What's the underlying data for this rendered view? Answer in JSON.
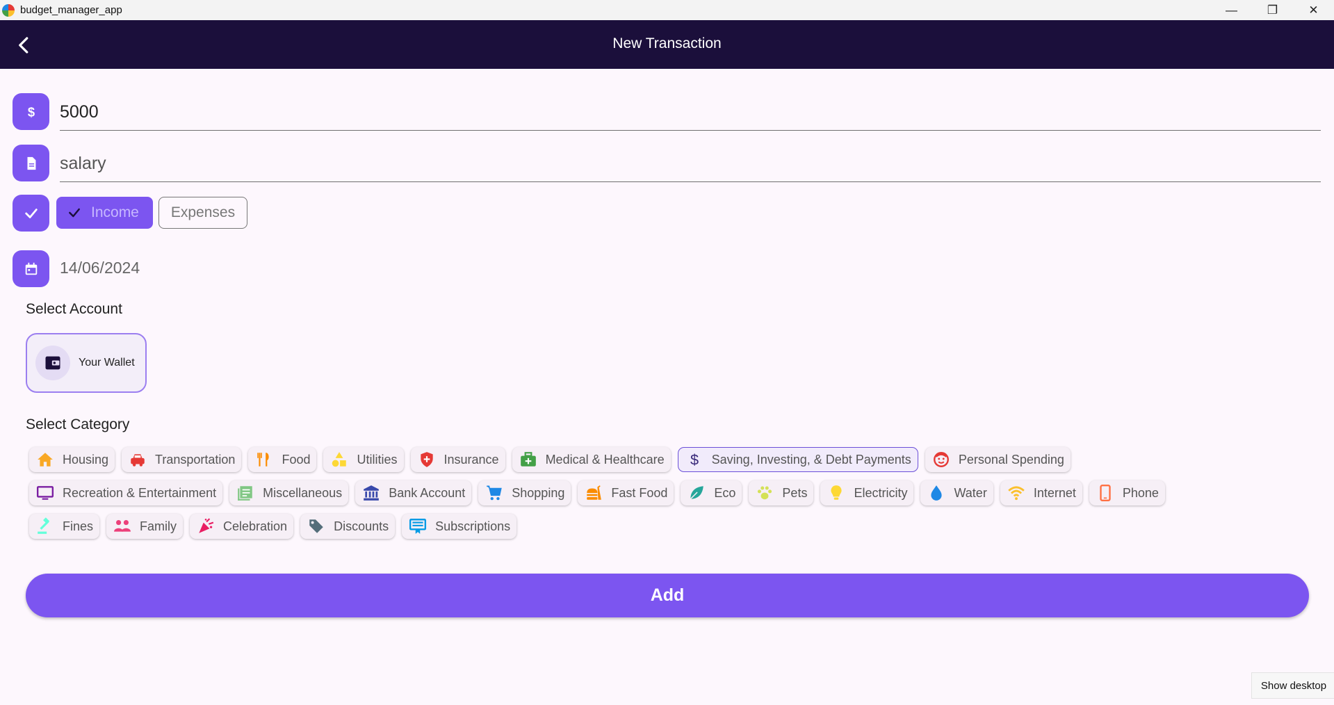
{
  "window": {
    "title": "budget_manager_app",
    "minimize": "—",
    "maximize": "❐",
    "close": "✕"
  },
  "appbar": {
    "title": "New Transaction"
  },
  "form": {
    "amount": "5000",
    "description": "salary",
    "type_options": {
      "income": "Income",
      "expenses": "Expenses",
      "selected": "Income"
    },
    "date": "14/06/2024"
  },
  "account": {
    "section_label": "Select Account",
    "items": [
      {
        "label": "Your Wallet",
        "icon": "wallet-icon",
        "selected": true
      }
    ]
  },
  "category": {
    "section_label": "Select Category",
    "rows": [
      [
        {
          "label": "Housing",
          "icon": "home-icon",
          "color": "#f9a825"
        },
        {
          "label": "Transportation",
          "icon": "car-icon",
          "color": "#e53935"
        },
        {
          "label": "Food",
          "icon": "utensils-icon",
          "color": "#fb8c00"
        },
        {
          "label": "Utilities",
          "icon": "shapes-icon",
          "color": "#fdd835"
        },
        {
          "label": "Insurance",
          "icon": "shield-icon",
          "color": "#e53935"
        },
        {
          "label": "Medical & Healthcare",
          "icon": "medical-kit-icon",
          "color": "#43a047"
        },
        {
          "label": "Saving, Investing, & Debt Payments",
          "icon": "dollar-icon",
          "color": "#3a2a7a",
          "selected": true
        },
        {
          "label": "Personal Spending",
          "icon": "face-icon",
          "color": "#e53935"
        }
      ],
      [
        {
          "label": "Recreation & Entertainment",
          "icon": "monitor-icon",
          "color": "#7b1fa2"
        },
        {
          "label": "Miscellaneous",
          "icon": "list-icon",
          "color": "#81c784"
        },
        {
          "label": "Bank Account",
          "icon": "bank-icon",
          "color": "#3949ab"
        },
        {
          "label": "Shopping",
          "icon": "cart-icon",
          "color": "#1e88e5"
        },
        {
          "label": "Fast Food",
          "icon": "fastfood-icon",
          "color": "#fb8c00"
        },
        {
          "label": "Eco",
          "icon": "leaf-icon",
          "color": "#26a69a"
        },
        {
          "label": "Pets",
          "icon": "paw-icon",
          "color": "#d4e157"
        },
        {
          "label": "Electricity",
          "icon": "bulb-icon",
          "color": "#fdd835"
        },
        {
          "label": "Water",
          "icon": "drop-icon",
          "color": "#1e88e5"
        },
        {
          "label": "Internet",
          "icon": "wifi-icon",
          "color": "#fbc02d"
        },
        {
          "label": "Phone",
          "icon": "phone-icon",
          "color": "#ff7043"
        }
      ],
      [
        {
          "label": "Fines",
          "icon": "gavel-icon",
          "color": "#64ffda"
        },
        {
          "label": "Family",
          "icon": "family-icon",
          "color": "#ec407a"
        },
        {
          "label": "Celebration",
          "icon": "party-icon",
          "color": "#e91e63"
        },
        {
          "label": "Discounts",
          "icon": "tag-icon",
          "color": "#546e7a"
        },
        {
          "label": "Subscriptions",
          "icon": "subscriptions-icon",
          "color": "#039be5"
        }
      ]
    ]
  },
  "actions": {
    "add": "Add"
  },
  "tooltip": "Show desktop",
  "colors": {
    "accent": "#7c55f0",
    "appbar": "#1b0f3b",
    "background": "#fdf7fd"
  }
}
